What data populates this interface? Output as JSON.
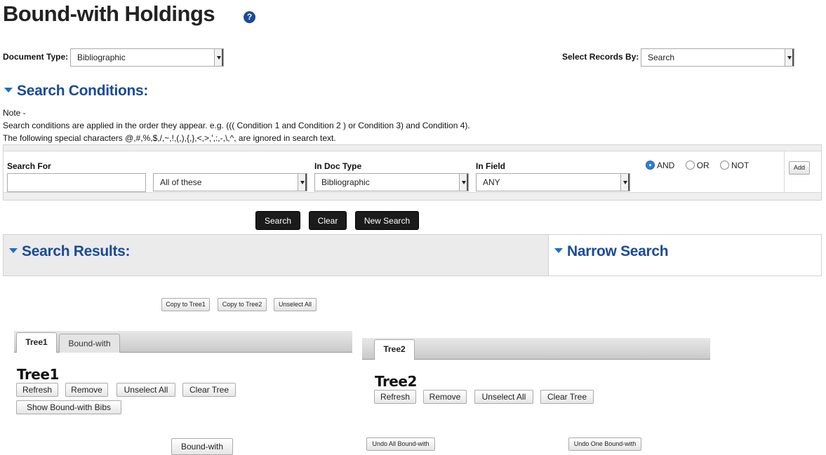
{
  "page": {
    "title": "Bound-with Holdings",
    "help_glyph": "?"
  },
  "filters": {
    "doc_type_label": "Document Type:",
    "doc_type_value": "Bibliographic",
    "select_by_label": "Select Records By:",
    "select_by_value": "Search"
  },
  "search_conditions": {
    "heading": "Search Conditions:",
    "note_title": "Note -",
    "note_line1": "Search conditions are applied in the order they appear. e.g. ((( Condition 1 and Condition 2 ) or Condition 3) and Condition 4).",
    "note_line2": "The following special characters @,#,%,$,/,~,!,(,),{,},<,>,',:,-,\\,^, are ignored in search text.",
    "search_for_label": "Search For",
    "search_for_value": "",
    "match_value": "All of these",
    "in_doc_type_label": "In Doc Type",
    "in_doc_type_value": "Bibliographic",
    "in_field_label": "In Field",
    "in_field_value": "ANY",
    "op_and": "AND",
    "op_or": "OR",
    "op_not": "NOT",
    "add_label": "Add"
  },
  "actions": {
    "search": "Search",
    "clear": "Clear",
    "new_search": "New Search"
  },
  "results": {
    "heading": "Search Results:",
    "narrow_heading": "Narrow Search"
  },
  "copy_actions": {
    "copy_tree1": "Copy to Tree1",
    "copy_tree2": "Copy to Tree2",
    "unselect_all": "Unselect All"
  },
  "tree1": {
    "tabs": [
      "Tree1",
      "Bound-with"
    ],
    "title": "Tree1",
    "refresh": "Refresh",
    "remove": "Remove",
    "unselect_all": "Unselect All",
    "clear_tree": "Clear Tree",
    "show_bibs": "Show Bound-with Bibs"
  },
  "tree2": {
    "tabs": [
      "Tree2"
    ],
    "title": "Tree2",
    "refresh": "Refresh",
    "remove": "Remove",
    "unselect_all": "Unselect All",
    "clear_tree": "Clear Tree"
  },
  "bottom": {
    "bound_with": "Bound-with",
    "undo_all": "Undo All Bound-with",
    "undo_one": "Undo One Bound-with"
  }
}
